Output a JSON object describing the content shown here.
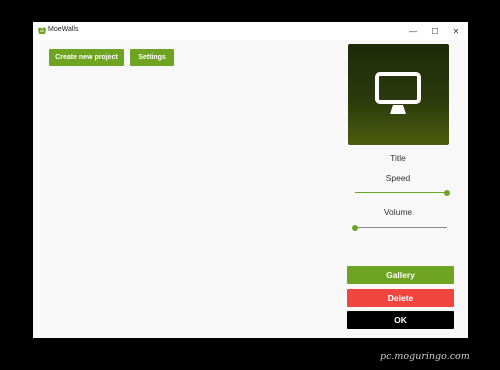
{
  "window": {
    "title": "MoeWalls",
    "controls": {
      "minimize": "—",
      "maximize": "☐",
      "close": "✕"
    }
  },
  "toolbar": {
    "create_label": "Create new project",
    "settings_label": "Settings"
  },
  "preview": {
    "icon": "monitor-icon"
  },
  "details": {
    "title_label": "Title",
    "speed_label": "Speed",
    "speed_value": 1.0,
    "volume_label": "Volume",
    "volume_value": 0.0
  },
  "actions": {
    "gallery_label": "Gallery",
    "delete_label": "Delete",
    "ok_label": "OK"
  },
  "watermark": "pc.moguringo.com",
  "colors": {
    "accent_green": "#6fa322",
    "delete_red": "#f0463f",
    "ok_black": "#000000"
  }
}
